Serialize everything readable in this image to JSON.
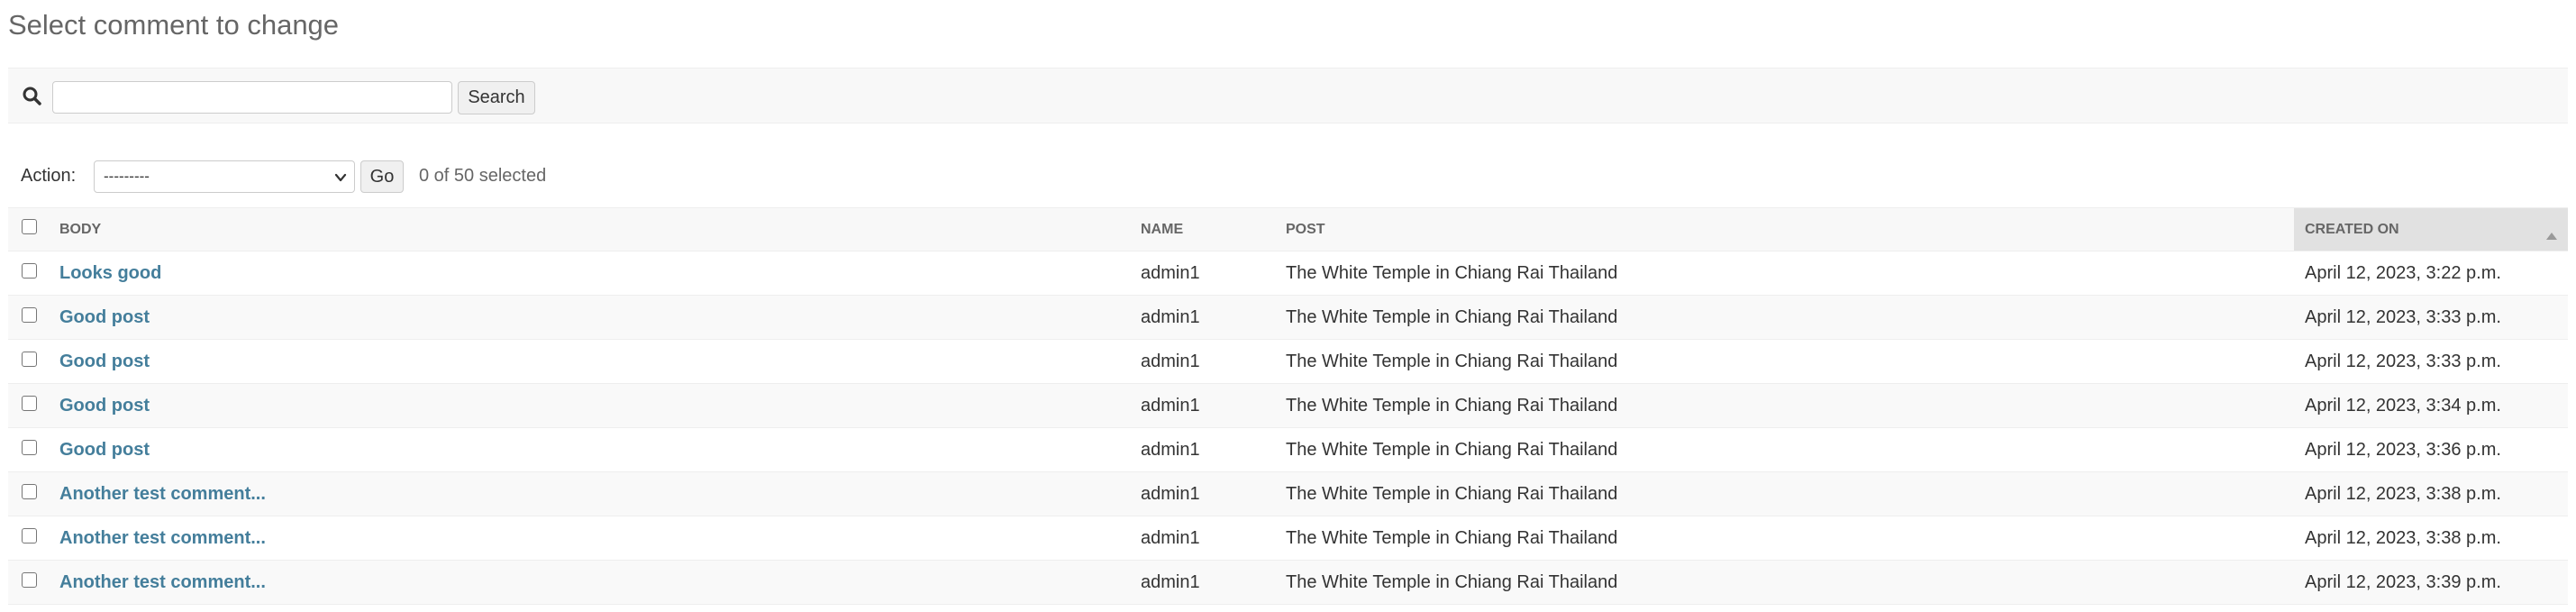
{
  "page": {
    "title": "Select comment to change"
  },
  "search": {
    "value": "",
    "placeholder": "",
    "button_label": "Search"
  },
  "actions": {
    "label": "Action:",
    "selected_option": "---------",
    "go_label": "Go",
    "selection_counter": "0 of 50 selected"
  },
  "table": {
    "columns": {
      "body": "Body",
      "name": "Name",
      "post": "Post",
      "created_on": "Created on"
    },
    "sorted_column": "created_on",
    "sort_direction": "ascending",
    "rows": [
      {
        "body": "Looks good",
        "name": "admin1",
        "post": "The White Temple in Chiang Rai Thailand",
        "created_on": "April 12, 2023, 3:22 p.m."
      },
      {
        "body": "Good post",
        "name": "admin1",
        "post": "The White Temple in Chiang Rai Thailand",
        "created_on": "April 12, 2023, 3:33 p.m."
      },
      {
        "body": "Good post",
        "name": "admin1",
        "post": "The White Temple in Chiang Rai Thailand",
        "created_on": "April 12, 2023, 3:33 p.m."
      },
      {
        "body": "Good post",
        "name": "admin1",
        "post": "The White Temple in Chiang Rai Thailand",
        "created_on": "April 12, 2023, 3:34 p.m."
      },
      {
        "body": "Good post",
        "name": "admin1",
        "post": "The White Temple in Chiang Rai Thailand",
        "created_on": "April 12, 2023, 3:36 p.m."
      },
      {
        "body": "Another test comment...",
        "name": "admin1",
        "post": "The White Temple in Chiang Rai Thailand",
        "created_on": "April 12, 2023, 3:38 p.m."
      },
      {
        "body": "Another test comment...",
        "name": "admin1",
        "post": "The White Temple in Chiang Rai Thailand",
        "created_on": "April 12, 2023, 3:38 p.m."
      },
      {
        "body": "Another test comment...",
        "name": "admin1",
        "post": "The White Temple in Chiang Rai Thailand",
        "created_on": "April 12, 2023, 3:39 p.m."
      }
    ]
  },
  "colors": {
    "link": "#447e9b",
    "header_bg": "#f8f8f8",
    "sorted_header_bg": "#e1e1e1",
    "title": "#666666"
  },
  "icons": {
    "search": "search-icon",
    "select_chevron": "chevron-down-icon",
    "sort": "sort-ascending-icon"
  }
}
